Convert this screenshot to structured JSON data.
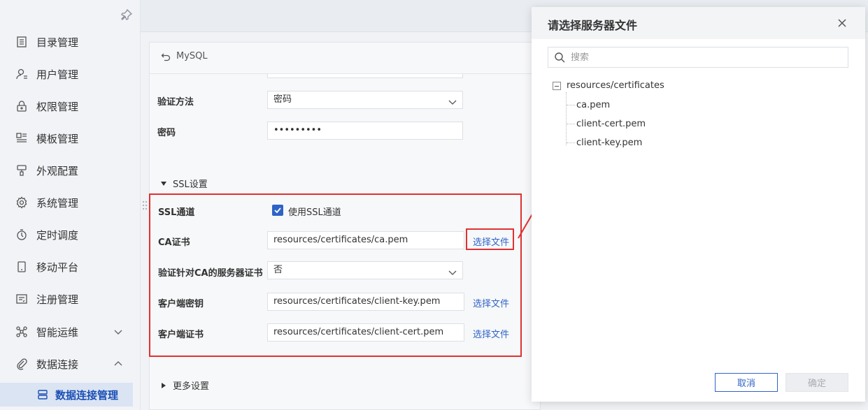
{
  "sidebar": {
    "items": [
      {
        "label": "目录管理",
        "icon": "catalog-icon"
      },
      {
        "label": "用户管理",
        "icon": "user-icon"
      },
      {
        "label": "权限管理",
        "icon": "lock-icon"
      },
      {
        "label": "模板管理",
        "icon": "template-icon"
      },
      {
        "label": "外观配置",
        "icon": "brush-icon"
      },
      {
        "label": "系统管理",
        "icon": "gear-icon"
      },
      {
        "label": "定时调度",
        "icon": "timer-icon"
      },
      {
        "label": "移动平台",
        "icon": "mobile-icon"
      },
      {
        "label": "注册管理",
        "icon": "register-icon"
      },
      {
        "label": "智能运维",
        "icon": "ops-icon"
      },
      {
        "label": "数据连接",
        "icon": "link-icon"
      }
    ],
    "active_sub": "数据连接管理"
  },
  "panel": {
    "back_label": "MySQL",
    "auth_label": "验证方法",
    "auth_value": "密码",
    "password_label": "密码",
    "password_value": "•••••••••",
    "ssl_section": "SSL设置",
    "ssl_channel_label": "SSL通道",
    "ssl_checkbox_label": "使用SSL通道",
    "ca_label": "CA证书",
    "ca_value": "resources/certificates/ca.pem",
    "choose_file": "选择文件",
    "verify_label": "验证针对CA的服务器证书",
    "verify_value": "否",
    "client_key_label": "客户端密钥",
    "client_key_value": "resources/certificates/client-key.pem",
    "client_cert_label": "客户端证书",
    "client_cert_value": "resources/certificates/client-cert.pem",
    "more_section": "更多设置"
  },
  "dialog": {
    "title": "请选择服务器文件",
    "search_placeholder": "搜索",
    "tree_root": "resources/certificates",
    "tree_items": [
      "ca.pem",
      "client-cert.pem",
      "client-key.pem"
    ],
    "cancel": "取消",
    "confirm": "确定"
  },
  "colors": {
    "accent": "#2f64c7",
    "highlight": "#e03131"
  }
}
